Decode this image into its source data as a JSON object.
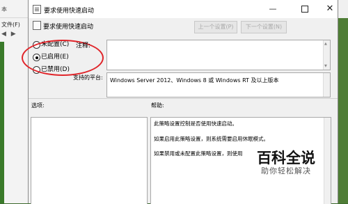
{
  "background_window": {
    "title": "本",
    "menu": "文件(F)",
    "nav": "◀ ▶"
  },
  "dialog": {
    "title": "要求使用快速启动",
    "controls": {
      "minimize": "—",
      "close": "✕"
    },
    "header_title": "要求使用快速启动",
    "prev_button": "上一个设置(P)",
    "next_button": "下一个设置(N)",
    "radio_options": [
      {
        "label": "未配置(C)",
        "selected": false
      },
      {
        "label": "已启用(E)",
        "selected": true
      },
      {
        "label": "已禁用(D)",
        "selected": false
      }
    ],
    "comment_label": "注释:",
    "comment_value": "",
    "platform_label": "支持的平台:",
    "platform_value": "Windows Server 2012、Windows 8 或 Windows RT 及以上版本",
    "options_label": "选项:",
    "help_label": "帮助:",
    "help_lines": [
      "此策略设置控制是否使用快速启动。",
      "如果启用此策略设置，则系统需要启用休眠模式。",
      "如果禁用或未配置此策略设置，则使用"
    ]
  },
  "watermark": {
    "title": "百科全说",
    "subtitle": "助你轻松解决"
  },
  "colors": {
    "highlight": "#e0252a",
    "dialog_bg": "#f0f0f0",
    "disabled_text": "#a8a8a8"
  },
  "icons": [
    "policy-icon",
    "minimize-icon",
    "maximize-icon",
    "close-icon"
  ]
}
